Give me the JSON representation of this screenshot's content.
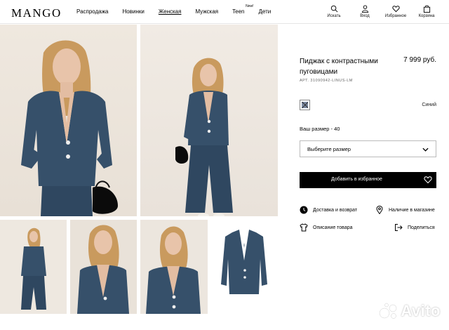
{
  "header": {
    "logo": "MANGO",
    "nav": [
      {
        "label": "Распродажа",
        "active": false
      },
      {
        "label": "Новинки",
        "active": false
      },
      {
        "label": "Женская",
        "active": true
      },
      {
        "label": "Мужская",
        "active": false
      },
      {
        "label": "Teen",
        "active": false,
        "badge": "New!"
      },
      {
        "label": "Дети",
        "active": false
      }
    ],
    "tools": [
      {
        "label": "Искать",
        "icon": "search-icon"
      },
      {
        "label": "Вход",
        "icon": "user-icon"
      },
      {
        "label": "Избранное",
        "icon": "heart-icon"
      },
      {
        "label": "Корзина",
        "icon": "bag-icon"
      }
    ]
  },
  "product": {
    "name": "Пиджак с контрастными пуговицами",
    "price": "7 999 руб.",
    "sku": "АРТ. 31090942-LINUS-LM",
    "color_name": "Синий",
    "swatch_color": "#7d8ba3",
    "size_label": "Ваш размер - 40",
    "size_select": "Выберите размер",
    "add_button": "Добавить в избранное"
  },
  "links": [
    {
      "label": "Доставка и возврат",
      "icon": "clock-icon"
    },
    {
      "label": "Наличие в магазине",
      "icon": "location-pin-icon"
    },
    {
      "label": "Описание товара",
      "icon": "shirt-icon"
    },
    {
      "label": "Поделиться",
      "icon": "share-icon"
    }
  ],
  "watermark": "Avito",
  "colors": {
    "jacket": "#36506a",
    "jacket_dark": "#243a50",
    "skin": "#e6c0a6",
    "hair": "#c99a5e",
    "button_black": "#000000"
  }
}
